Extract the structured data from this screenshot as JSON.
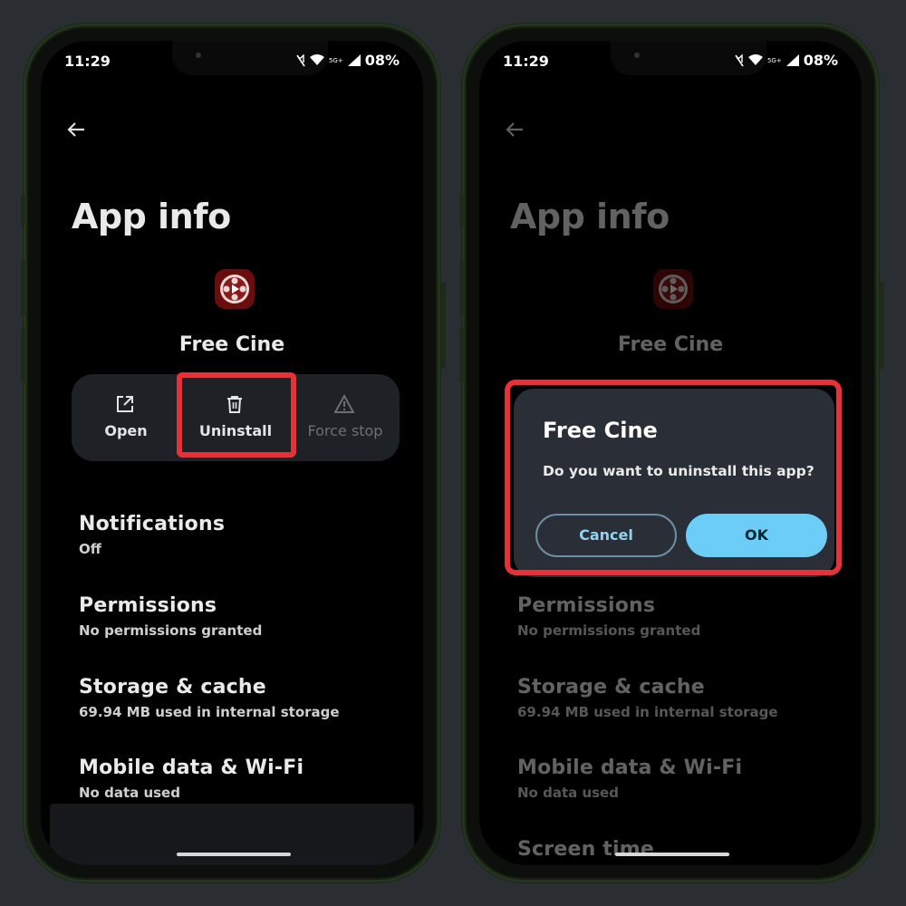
{
  "status_bar": {
    "time": "11:29",
    "network": "5G+",
    "battery": "08%"
  },
  "left_screen": {
    "title": "App info",
    "app_name": "Free Cine",
    "actions": [
      {
        "label": "Open",
        "icon": "open-external-icon"
      },
      {
        "label": "Uninstall",
        "icon": "trash-icon"
      },
      {
        "label": "Force stop",
        "icon": "warning-icon"
      }
    ],
    "settings": [
      {
        "title": "Notifications",
        "subtitle": "Off"
      },
      {
        "title": "Permissions",
        "subtitle": "No permissions granted"
      },
      {
        "title": "Storage & cache",
        "subtitle": "69.94 MB used in internal storage"
      },
      {
        "title": "Mobile data & Wi-Fi",
        "subtitle": "No data used"
      }
    ]
  },
  "right_screen": {
    "title": "App info",
    "app_name": "Free Cine",
    "dialog": {
      "title": "Free Cine",
      "message": "Do you want to uninstall this app?",
      "cancel_label": "Cancel",
      "ok_label": "OK"
    },
    "settings": [
      {
        "title": "Permissions",
        "subtitle": "No permissions granted"
      },
      {
        "title": "Storage & cache",
        "subtitle": "69.94 MB used in internal storage"
      },
      {
        "title": "Mobile data & Wi-Fi",
        "subtitle": "No data used"
      },
      {
        "title": "Screen time"
      }
    ]
  },
  "colors": {
    "highlight": "#e53137",
    "accent": "#6ccdf7"
  }
}
